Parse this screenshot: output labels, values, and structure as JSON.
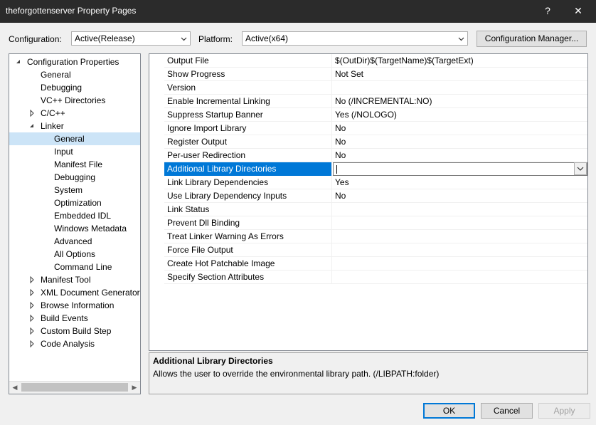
{
  "window": {
    "title": "theforgottenserver Property Pages",
    "help_glyph": "?",
    "close_glyph": "✕"
  },
  "toolbar": {
    "configuration_label": "Configuration:",
    "configuration_value": "Active(Release)",
    "platform_label": "Platform:",
    "platform_value": "Active(x64)",
    "config_manager_label": "Configuration Manager..."
  },
  "tree": {
    "items": [
      {
        "label": "Configuration Properties",
        "expander": "expanded"
      },
      {
        "label": "General",
        "expander": "none"
      },
      {
        "label": "Debugging",
        "expander": "none"
      },
      {
        "label": "VC++ Directories",
        "expander": "none"
      },
      {
        "label": "C/C++",
        "expander": "collapsed"
      },
      {
        "label": "Linker",
        "expander": "expanded"
      },
      {
        "label": "General",
        "expander": "none",
        "selected": true
      },
      {
        "label": "Input",
        "expander": "none"
      },
      {
        "label": "Manifest File",
        "expander": "none"
      },
      {
        "label": "Debugging",
        "expander": "none"
      },
      {
        "label": "System",
        "expander": "none"
      },
      {
        "label": "Optimization",
        "expander": "none"
      },
      {
        "label": "Embedded IDL",
        "expander": "none"
      },
      {
        "label": "Windows Metadata",
        "expander": "none"
      },
      {
        "label": "Advanced",
        "expander": "none"
      },
      {
        "label": "All Options",
        "expander": "none"
      },
      {
        "label": "Command Line",
        "expander": "none"
      },
      {
        "label": "Manifest Tool",
        "expander": "collapsed"
      },
      {
        "label": "XML Document Generator",
        "expander": "collapsed"
      },
      {
        "label": "Browse Information",
        "expander": "collapsed"
      },
      {
        "label": "Build Events",
        "expander": "collapsed"
      },
      {
        "label": "Custom Build Step",
        "expander": "collapsed"
      },
      {
        "label": "Code Analysis",
        "expander": "collapsed"
      }
    ]
  },
  "properties": [
    {
      "name": "Output File",
      "value": "$(OutDir)$(TargetName)$(TargetExt)"
    },
    {
      "name": "Show Progress",
      "value": "Not Set"
    },
    {
      "name": "Version",
      "value": ""
    },
    {
      "name": "Enable Incremental Linking",
      "value": "No (/INCREMENTAL:NO)"
    },
    {
      "name": "Suppress Startup Banner",
      "value": "Yes (/NOLOGO)"
    },
    {
      "name": "Ignore Import Library",
      "value": "No"
    },
    {
      "name": "Register Output",
      "value": "No"
    },
    {
      "name": "Per-user Redirection",
      "value": "No"
    },
    {
      "name": "Additional Library Directories",
      "value": "",
      "selected": true
    },
    {
      "name": "Link Library Dependencies",
      "value": "Yes"
    },
    {
      "name": "Use Library Dependency Inputs",
      "value": "No"
    },
    {
      "name": "Link Status",
      "value": ""
    },
    {
      "name": "Prevent Dll Binding",
      "value": ""
    },
    {
      "name": "Treat Linker Warning As Errors",
      "value": ""
    },
    {
      "name": "Force File Output",
      "value": ""
    },
    {
      "name": "Create Hot Patchable Image",
      "value": ""
    },
    {
      "name": "Specify Section Attributes",
      "value": ""
    }
  ],
  "description": {
    "title": "Additional Library Directories",
    "text": "Allows the user to override the environmental library path. (/LIBPATH:folder)"
  },
  "buttons": {
    "ok": "OK",
    "cancel": "Cancel",
    "apply": "Apply"
  }
}
